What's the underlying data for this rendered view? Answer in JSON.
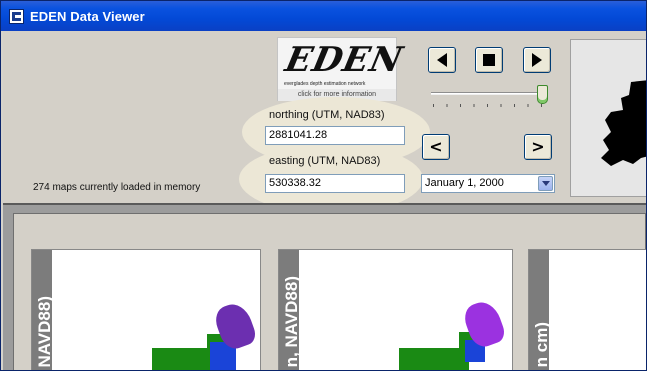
{
  "window": {
    "title": "EDEN Data Viewer"
  },
  "logo": {
    "word": "EDEN",
    "subtitle": "everglades depth estimation network",
    "link_text": "click for more information"
  },
  "status": {
    "maps_loaded_text": "274 maps currently loaded in memory"
  },
  "coordinates": {
    "northing_label": "northing (UTM, NAD83)",
    "northing_value": "2881041.28",
    "easting_label": "easting (UTM, NAD83)",
    "easting_value": "530338.32"
  },
  "playback": {
    "back_icon": "step-back-icon",
    "stop_icon": "stop-icon",
    "play_icon": "play-icon",
    "prev_label": "<",
    "next_label": ">",
    "slider_position": 1.0
  },
  "date": {
    "selected": "January 1, 2000"
  },
  "maps": {
    "panel_labels": [
      "NAVD88)",
      "n, NAVD88)",
      "n cm)"
    ]
  },
  "colors": {
    "titlebar": "#0349d6",
    "highlight": "#ece7d6",
    "depth_high": "#6c2fb0",
    "depth_mid": "#1a44d8",
    "depth_low": "#1a8a14"
  }
}
